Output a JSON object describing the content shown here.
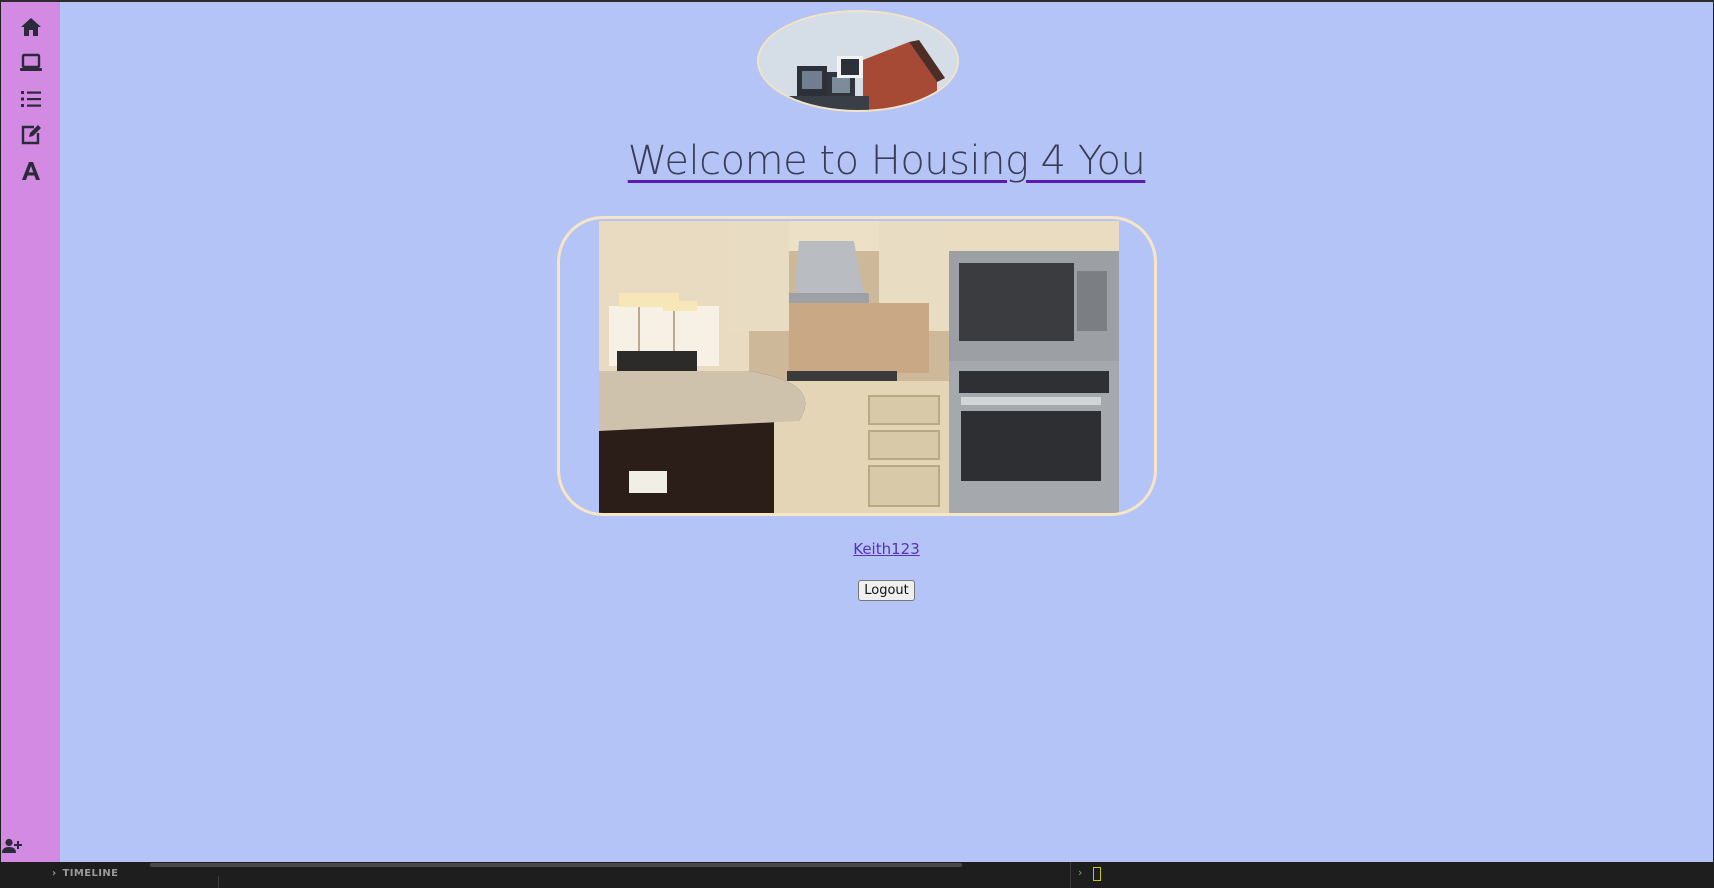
{
  "page": {
    "title": "Welcome to Housing 4 You",
    "username": "Keith123",
    "logout_label": "Logout"
  },
  "sidebar": {
    "items": [
      {
        "icon": "home-icon"
      },
      {
        "icon": "laptop-icon"
      },
      {
        "icon": "list-icon"
      },
      {
        "icon": "edit-icon"
      },
      {
        "icon": "font-icon"
      }
    ],
    "bottom_icon": "user-plus-icon"
  },
  "statusbar": {
    "timeline_label": "TIMELINE"
  },
  "colors": {
    "sidebar_bg": "#d28ae2",
    "main_bg": "#b5c4f7",
    "frame_border": "#f6e6c6",
    "link_color": "#5b2fb6"
  }
}
